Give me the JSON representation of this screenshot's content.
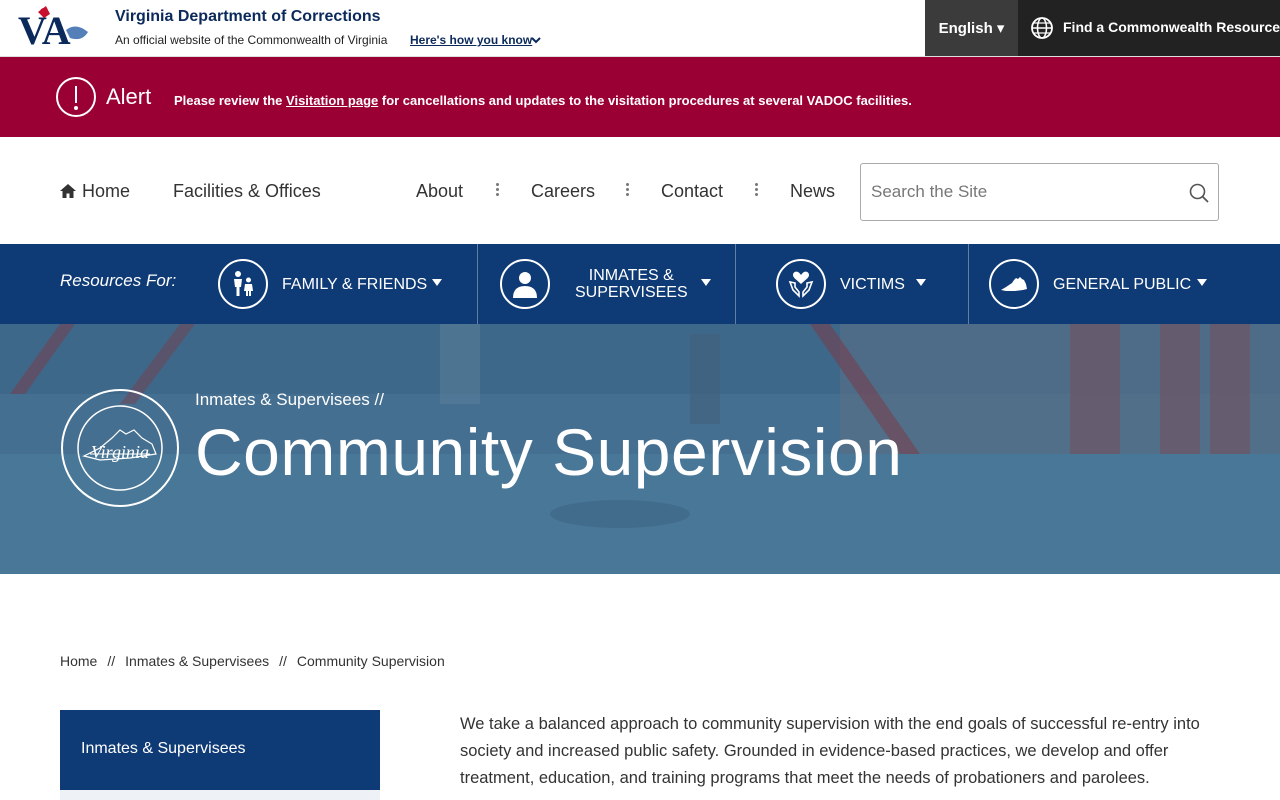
{
  "gov_bar": {
    "title": "Virginia Department of Corrections",
    "subtitle": "An official website of the Commonwealth of Virginia",
    "how_know": "Here's how you know",
    "language": "English ▾",
    "resource": "Find a Commonwealth Resource"
  },
  "alert": {
    "title": "Alert",
    "msg_before": "Please review the ",
    "msg_link": "Visitation page",
    "msg_after": " for cancellations and updates to the visitation procedures at several VADOC facilities."
  },
  "nav": {
    "home": "Home",
    "facilities": "Facilities & Offices",
    "about": "About",
    "careers": "Careers",
    "contact": "Contact",
    "news": "News",
    "search_placeholder": "Search the Site"
  },
  "resources": {
    "label": "Resources For:",
    "items": [
      {
        "label": "FAMILY & FRIENDS",
        "icon": "family-icon"
      },
      {
        "label_line1": "INMATES &",
        "label_line2": "SUPERVISEES",
        "icon": "person-icon"
      },
      {
        "label": "VICTIMS",
        "icon": "heart-hands-icon"
      },
      {
        "label": "GENERAL PUBLIC",
        "icon": "virginia-map-icon"
      }
    ]
  },
  "hero": {
    "crumb": "Inmates & Supervisees  //",
    "title": "Community Supervision"
  },
  "breadcrumb": {
    "items": [
      "Home",
      "Inmates & Supervisees",
      "Community Supervision"
    ],
    "separator": "//"
  },
  "sidenav": {
    "active": "Inmates & Supervisees"
  },
  "content": {
    "paragraph": "We take a balanced approach to community supervision with the end goals of successful re-entry into society and increased public safety. Grounded in evidence-based practices, we develop and offer treatment, education, and training programs that meet the needs of probationers and parolees."
  },
  "colors": {
    "navy": "#0e3a75",
    "alert_red": "#9b0035",
    "dark_title": "#0b2a5b"
  }
}
